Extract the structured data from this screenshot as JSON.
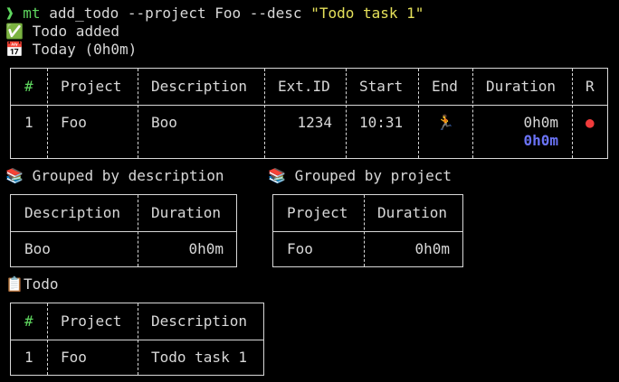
{
  "prompt": {
    "symbol": "❱",
    "command": "mt",
    "args": "add_todo --project Foo --desc",
    "quoted": "\"Todo task 1\""
  },
  "messages": {
    "added_icon": "✅",
    "added_text": "Todo added",
    "today_icon": "📅",
    "today_text": "Today (0h0m)"
  },
  "main_table": {
    "headers": [
      "#",
      "Project",
      "Description",
      "Ext.ID",
      "Start",
      "End",
      "Duration",
      "R"
    ],
    "rows": [
      {
        "num": "1",
        "project": "Foo",
        "description": "Boo",
        "ext_id": "1234",
        "start": "10:31",
        "end_icon": "🏃",
        "duration": "0h0m",
        "duration_total": "0h0m",
        "running_icon": "●"
      }
    ]
  },
  "grouped_desc": {
    "icon": "📚",
    "title": "Grouped by description",
    "headers": [
      "Description",
      "Duration"
    ],
    "rows": [
      {
        "description": "Boo",
        "duration": "0h0m"
      }
    ]
  },
  "grouped_project": {
    "icon": "📚",
    "title": "Grouped by project",
    "headers": [
      "Project",
      "Duration"
    ],
    "rows": [
      {
        "project": "Foo",
        "duration": "0h0m"
      }
    ]
  },
  "todo": {
    "icon": "📋",
    "title": "Todo",
    "headers": [
      "#",
      "Project",
      "Description"
    ],
    "rows": [
      {
        "num": "1",
        "project": "Foo",
        "description": "Todo task 1"
      }
    ]
  },
  "colors": {
    "background": "#000000",
    "text": "#d8d8d8",
    "prompt_green": "#5fd75f",
    "string_yellow": "#e5e05a",
    "total_blue": "#6a73f6",
    "running_red": "#f03b3b"
  }
}
